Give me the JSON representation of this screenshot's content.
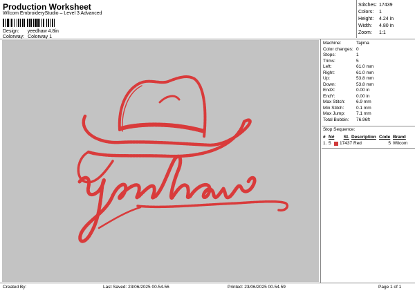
{
  "header": {
    "title": "Production Worksheet",
    "subtitle": "Wilcom EmbroideryStudio – Level 3 Advanced",
    "design_label": "Design:",
    "design_value": "yeedhaw 4.8in",
    "colorway_label": "Colorway:",
    "colorway_value": "Colorway 1"
  },
  "stats": {
    "stitches_label": "Stitches:",
    "stitches": "17439",
    "colors_label": "Colors:",
    "colors": "1",
    "height_label": "Height:",
    "height": "4.24 in",
    "width_label": "Width:",
    "width": "4.80 in",
    "zoom_label": "Zoom:",
    "zoom": "1:1"
  },
  "machine_info": [
    {
      "label": "Machine:",
      "value": "Tajima"
    },
    {
      "label": "Color changes:",
      "value": "0"
    },
    {
      "label": "Stops:",
      "value": "1"
    },
    {
      "label": "Trims:",
      "value": "5"
    },
    {
      "label": "Left:",
      "value": "61.0 mm"
    },
    {
      "label": "Right:",
      "value": "61.0 mm"
    },
    {
      "label": "Up:",
      "value": "53.8 mm"
    },
    {
      "label": "Down:",
      "value": "53.8 mm"
    },
    {
      "label": "EndX:",
      "value": "0.00 in"
    },
    {
      "label": "EndY:",
      "value": "0.00 in"
    },
    {
      "label": "Max Stitch:",
      "value": "6.9 mm"
    },
    {
      "label": "Min Stitch:",
      "value": "0.1 mm"
    },
    {
      "label": "Max Jump:",
      "value": "7.1 mm"
    },
    {
      "label": "Total Bobbin:",
      "value": "76.96ft"
    }
  ],
  "stop_sequence": {
    "title": "Stop Sequence:",
    "headers": [
      "#",
      "N#",
      "St.",
      "Description",
      "Code",
      "Brand"
    ],
    "rows": [
      {
        "num": "1.",
        "n": "5",
        "color": "#d03a3a",
        "st": "17437",
        "description": "Red",
        "code": "5",
        "brand": "Wilcom"
      }
    ]
  },
  "design": {
    "text": "yeehaw",
    "thread_color": "#d93b3b",
    "background": "#c3c3c3"
  },
  "footer": {
    "created": "Created By:",
    "saved": "Last Saved: 23/06/2025 00.54.56",
    "printed": "Printed: 23/06/2025 00.54.59",
    "page": "Page 1 of 1"
  }
}
